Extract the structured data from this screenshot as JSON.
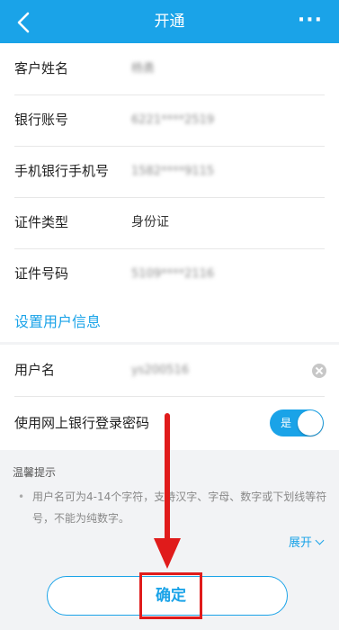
{
  "header": {
    "title": "开通",
    "more_label": "···"
  },
  "account_info": [
    {
      "label": "客户姓名",
      "value": "杨勇",
      "blurred": true
    },
    {
      "label": "银行账号",
      "value": "6221****2519",
      "blurred": true
    },
    {
      "label": "手机银行手机号",
      "value": "1582****9115",
      "blurred": true
    },
    {
      "label": "证件类型",
      "value": "身份证",
      "blurred": false
    },
    {
      "label": "证件号码",
      "value": "5109****2116",
      "blurred": true
    }
  ],
  "user_section": {
    "title": "设置用户信息",
    "username_label": "用户名",
    "username_value": "ys200516",
    "use_password_label": "使用网上银行登录密码",
    "toggle_text": "是",
    "toggle_on": true
  },
  "tips": {
    "title": "温馨提示",
    "bullet": "•",
    "text": "用户名可为4-14个字符，支持汉字、字母、数字或下划线等符号，不能为纯数字。",
    "expand_label": "展开"
  },
  "confirm_label": "确定",
  "colors": {
    "accent": "#1aa3e8",
    "highlight": "#e01b1b"
  }
}
